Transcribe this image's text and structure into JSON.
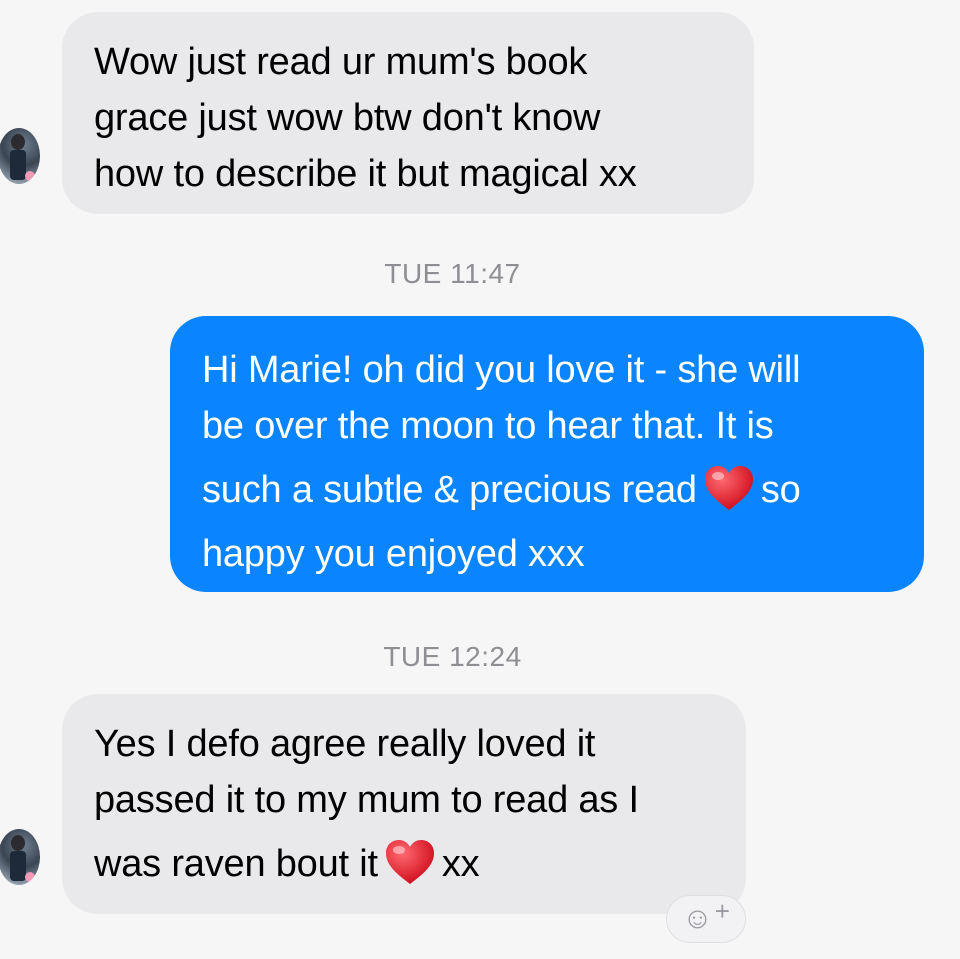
{
  "messages": [
    {
      "direction": "incoming",
      "lines": [
        "Wow just read ur mum's book",
        "grace just wow btw don't know",
        "how to describe it but magical xx"
      ]
    },
    {
      "direction": "outgoing",
      "lines": [
        "Hi Marie! oh did you love it - she will",
        "be over the moon to hear that. It is",
        "such a subtle & precious read",
        "so",
        "happy you enjoyed xxx"
      ]
    },
    {
      "direction": "incoming",
      "lines": [
        "Yes I defo agree really loved it",
        "passed it to my mum to read as I",
        "was raven bout it",
        "xx"
      ]
    }
  ],
  "timestamps": [
    "TUE 11:47",
    "TUE 12:24"
  ],
  "icons": {
    "avatar": "contact-avatar",
    "heart": "red-heart-emoji",
    "reaction": "add-reaction-smiley-icon"
  },
  "reaction_button": {
    "smiley": "☺",
    "plus": "+"
  },
  "colors": {
    "background": "#f6f6f7",
    "incoming_bubble": "#e9e9eb",
    "outgoing_bubble": "#0a84ff",
    "timestamp": "#8e8e93",
    "heart": "#e0202a"
  }
}
